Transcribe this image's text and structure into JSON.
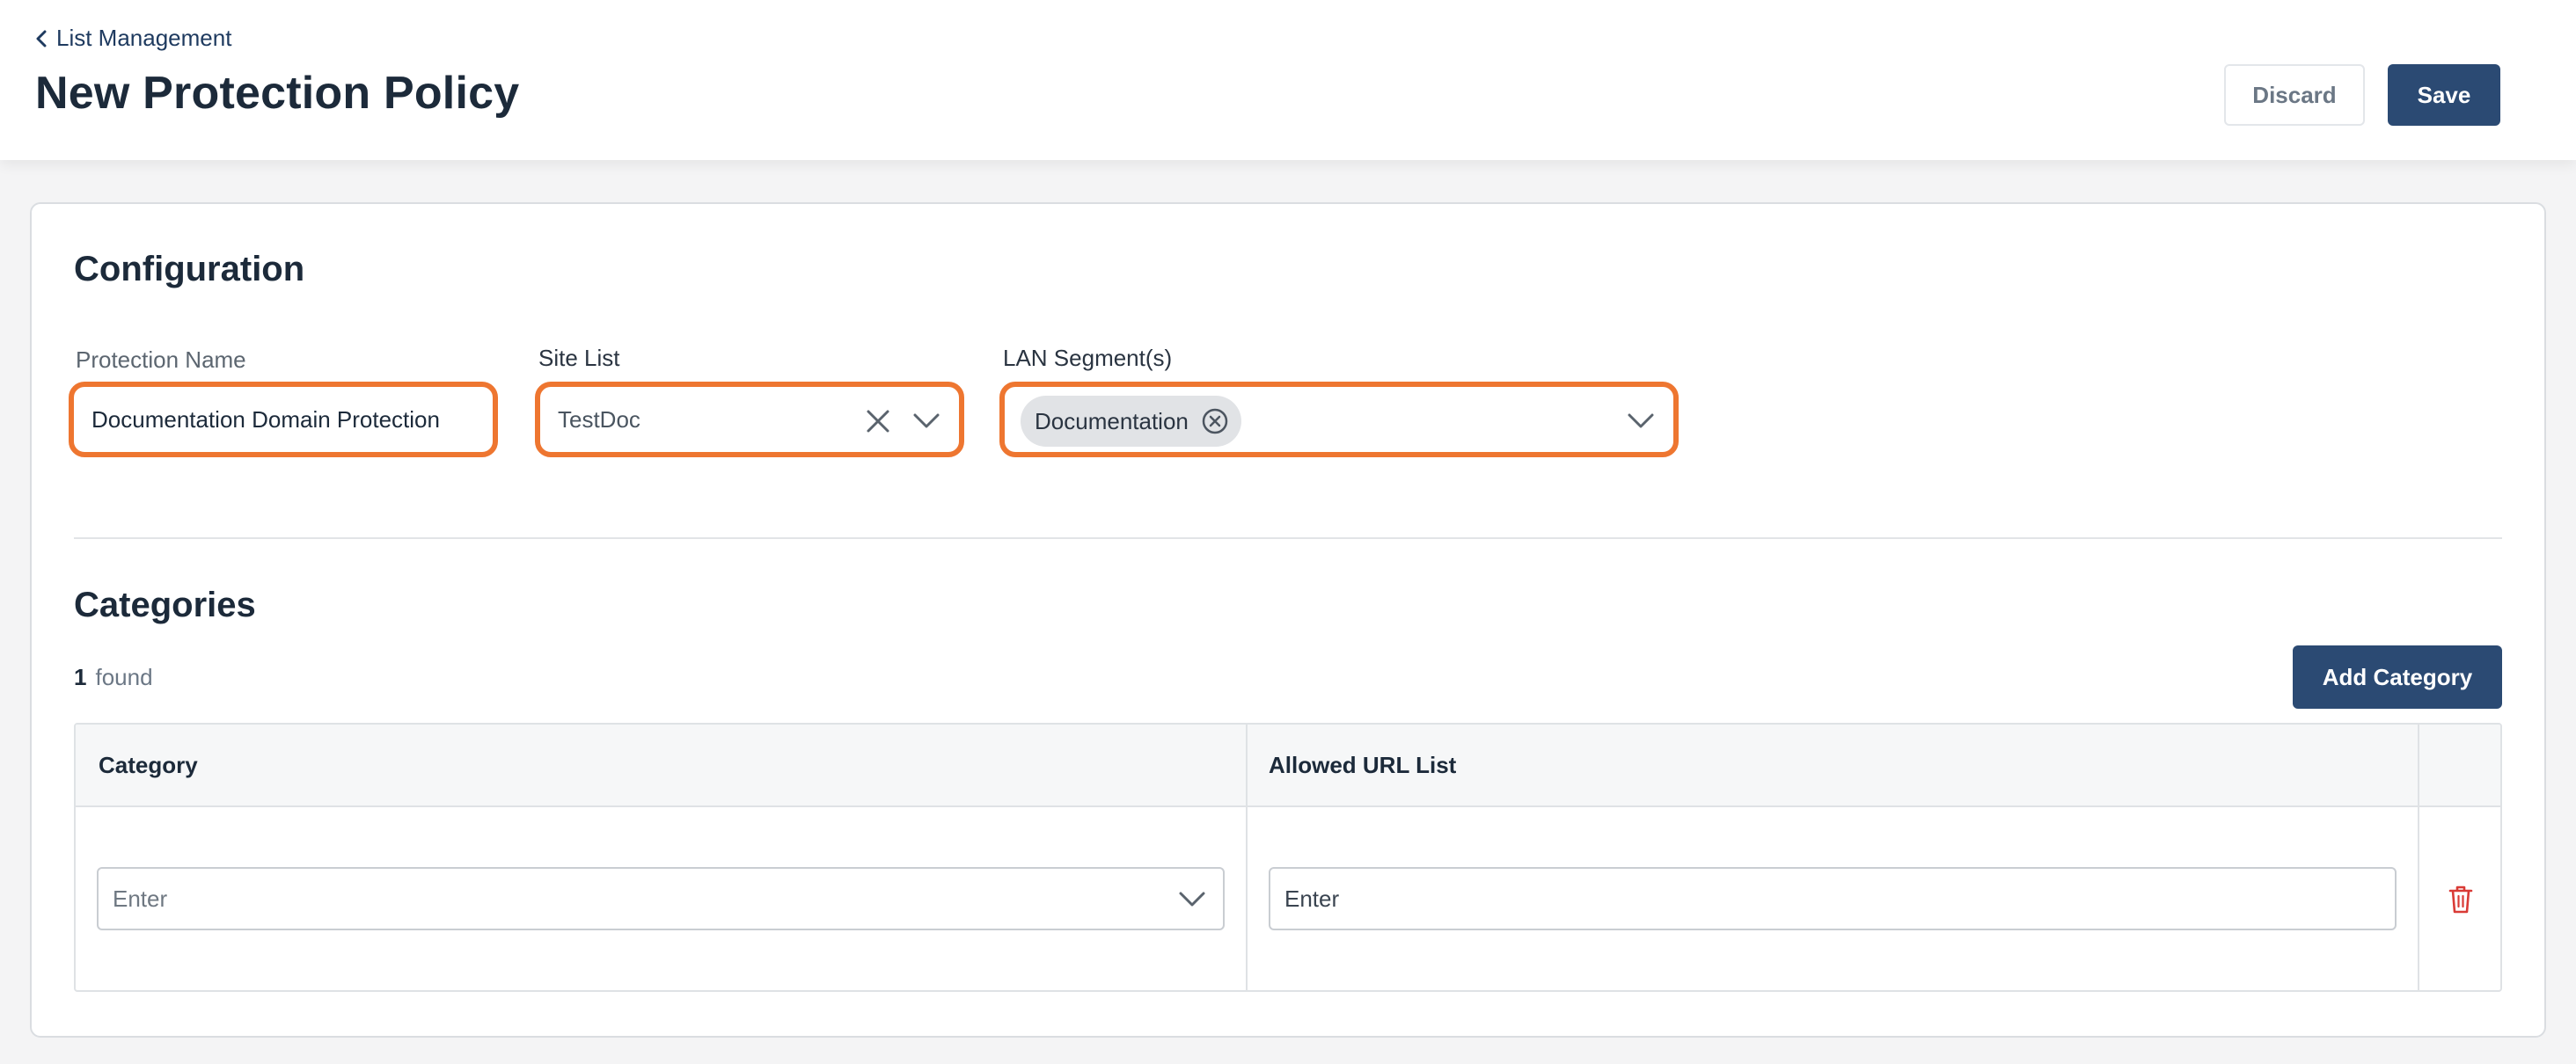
{
  "header": {
    "breadcrumb": "List Management",
    "title": "New Protection Policy",
    "discard_label": "Discard",
    "save_label": "Save"
  },
  "configuration": {
    "title": "Configuration",
    "protection_name": {
      "label": "Protection Name",
      "value": "Documentation Domain Protection"
    },
    "site_list": {
      "label": "Site List",
      "value": "TestDoc"
    },
    "lan_segments": {
      "label": "LAN Segment(s)",
      "chips": [
        "Documentation"
      ]
    }
  },
  "categories": {
    "title": "Categories",
    "found_count": "1",
    "found_text": "found",
    "add_label": "Add Category",
    "columns": [
      "Category",
      "Allowed URL List"
    ],
    "rows": [
      {
        "category_placeholder": "Enter",
        "url_placeholder": "Enter"
      }
    ]
  },
  "colors": {
    "primary": "#2b4a73",
    "highlight": "#ee7630",
    "danger": "#d93b36"
  }
}
